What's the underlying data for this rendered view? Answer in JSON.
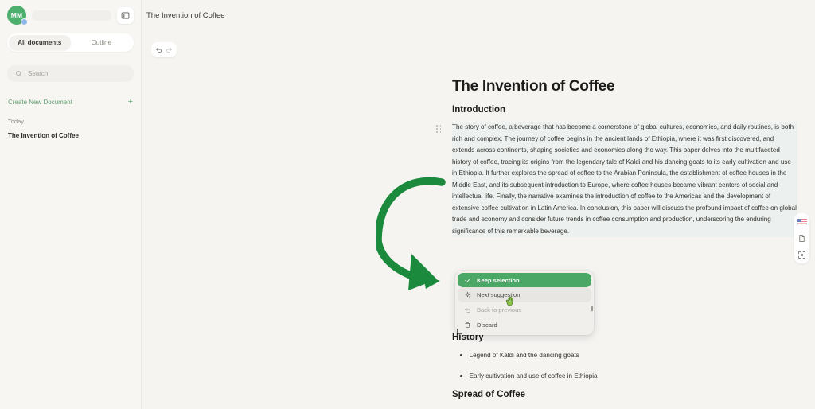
{
  "app": {
    "accent_green": "#4aa765",
    "sidebar_bg": "#f7f6f3",
    "canvas_bg": "#f5f4f1",
    "highlight_bg": "#ecf0ee"
  },
  "sidebar": {
    "avatar_initials": "MM",
    "panel_toggle_icon": "panel-left-icon",
    "tabs": [
      {
        "label": "All documents",
        "active": true
      },
      {
        "label": "Outline",
        "active": false
      }
    ],
    "search": {
      "placeholder": "Search",
      "value": "",
      "icon": "search-icon"
    },
    "create_new": {
      "label": "Create New Document",
      "plus": "+"
    },
    "sections": [
      {
        "label": "Today",
        "items": [
          {
            "title": "The Invention of Coffee",
            "active": true
          }
        ]
      }
    ]
  },
  "header": {
    "document_title": "The Invention of Coffee"
  },
  "toolbar": {
    "undo_icon": "undo-icon",
    "redo_icon": "redo-icon",
    "globe_icon": "globe-settings-icon",
    "more_icon": "more-horizontal-icon"
  },
  "right_rail": {
    "items": [
      {
        "name": "language-flag-icon",
        "label": "US"
      },
      {
        "name": "document-export-icon",
        "label": ""
      },
      {
        "name": "fullscreen-icon",
        "label": ""
      }
    ]
  },
  "document": {
    "title": "The Invention of Coffee",
    "heading_intro": "Introduction",
    "paragraph": "The story of coffee, a beverage that has become a cornerstone of global cultures, economies, and daily routines, is both rich and complex. The journey of coffee begins in the ancient lands of Ethiopia, where it was first discovered, and extends across continents, shaping societies and economies along the way. This paper delves into the multifaceted history of coffee, tracing its origins from the legendary tale of Kaldi and his dancing goats to its early cultivation and use in Ethiopia. It further explores the spread of coffee to the Arabian Peninsula, the establishment of coffee houses in the Middle East, and its subsequent introduction to Europe, where coffee houses became vibrant centers of social and intellectual life. Finally, the narrative examines the introduction of coffee to the Americas and the development of extensive coffee cultivation in Latin America. In conclusion, this paper will discuss the profound impact of coffee on global trade and economy and consider future trends in coffee consumption and production, underscoring the enduring significance of this remarkable beverage.",
    "heading_history": "History",
    "bullets": [
      "Legend of Kaldi and the dancing goats",
      "Early cultivation and use of coffee in Ethiopia"
    ],
    "heading_spread": "Spread of Coffee"
  },
  "suggestion_popup": {
    "items": [
      {
        "label": "Keep selection",
        "icon": "check-icon",
        "state": "primary"
      },
      {
        "label": "Next suggestion",
        "icon": "sparkle-icon",
        "state": "hovered"
      },
      {
        "label": "Back to previous",
        "icon": "undo-arrow-icon",
        "state": "disabled"
      },
      {
        "label": "Discard",
        "icon": "trash-icon",
        "state": "normal"
      }
    ]
  },
  "annotation": {
    "arrow_color": "#1b8a3c",
    "arrow_name": "green-curved-arrow"
  }
}
